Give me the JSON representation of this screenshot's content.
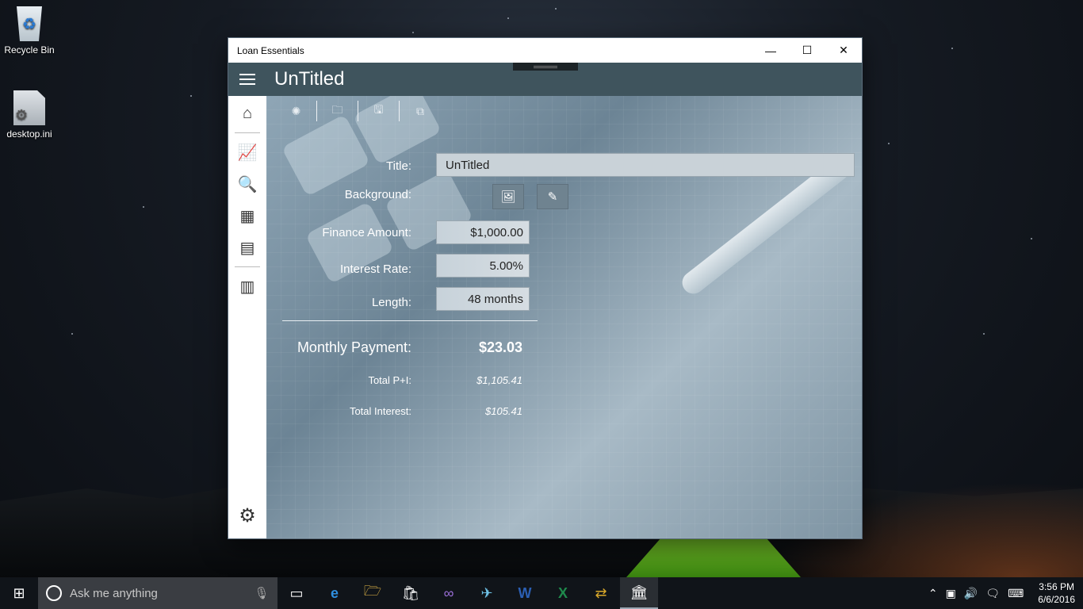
{
  "desktop": {
    "icons": [
      {
        "label": "Recycle Bin"
      },
      {
        "label": "desktop.ini"
      }
    ]
  },
  "window": {
    "title": "Loan Essentials",
    "controls": {
      "minimize": "—",
      "maximize": "☐",
      "close": "✕"
    }
  },
  "appbar": {
    "title": "UnTitled"
  },
  "toolbar": {
    "items": [
      "new-icon",
      "open-icon",
      "save-icon",
      "copy-icon"
    ],
    "glyphs": {
      "new": "✺",
      "open": "🗀",
      "save": "🖫",
      "copy": "⧉"
    }
  },
  "sidebar": {
    "items": [
      "home-icon",
      "chart-icon",
      "document-search-icon",
      "calendar-icon",
      "calendar-day-icon",
      "calculator-icon",
      "settings-icon"
    ],
    "glyphs": {
      "home": "⌂",
      "chart": "📈",
      "doc": "🔍",
      "cal": "▦",
      "calday": "▤",
      "calc": "▥",
      "gear": "⚙"
    }
  },
  "form": {
    "title_label": "Title:",
    "title_value": "UnTitled",
    "background_label": "Background:",
    "background_buttons": {
      "image": "🖼",
      "clear": "✎"
    },
    "finance_label": "Finance Amount:",
    "finance_value": "$1,000.00",
    "interest_label": "Interest Rate:",
    "interest_value": "5.00%",
    "length_label": "Length:",
    "length_value": "48 months"
  },
  "results": {
    "monthly_label": "Monthly Payment:",
    "monthly_value": "$23.03",
    "total_pi_label": "Total P+I:",
    "total_pi_value": "$1,105.41",
    "total_interest_label": "Total Interest:",
    "total_interest_value": "$105.41"
  },
  "taskbar": {
    "search_placeholder": "Ask me anything",
    "start_glyph": "⊞",
    "mic_glyph": "🎙",
    "apps": [
      {
        "name": "task-view-icon",
        "glyph": "▭"
      },
      {
        "name": "edge-icon",
        "glyph": "e"
      },
      {
        "name": "file-explorer-icon",
        "glyph": "🗁"
      },
      {
        "name": "store-icon",
        "glyph": "🛍"
      },
      {
        "name": "visual-studio-icon",
        "glyph": "∞"
      },
      {
        "name": "app-icon",
        "glyph": "✈"
      },
      {
        "name": "word-icon",
        "glyph": "W"
      },
      {
        "name": "excel-icon",
        "glyph": "X"
      },
      {
        "name": "app2-icon",
        "glyph": "⇄"
      },
      {
        "name": "loan-essentials-icon",
        "glyph": "🏛"
      }
    ],
    "tray": {
      "chevron": "⌃",
      "network": "▣",
      "volume": "🔊",
      "notifications": "🗨",
      "keyboard": "⌨"
    },
    "time": "3:56 PM",
    "date": "6/6/2016"
  },
  "colors": {
    "appbar": "#3f545d",
    "taskbar": "#101419",
    "search_bg": "#3a3d42"
  }
}
